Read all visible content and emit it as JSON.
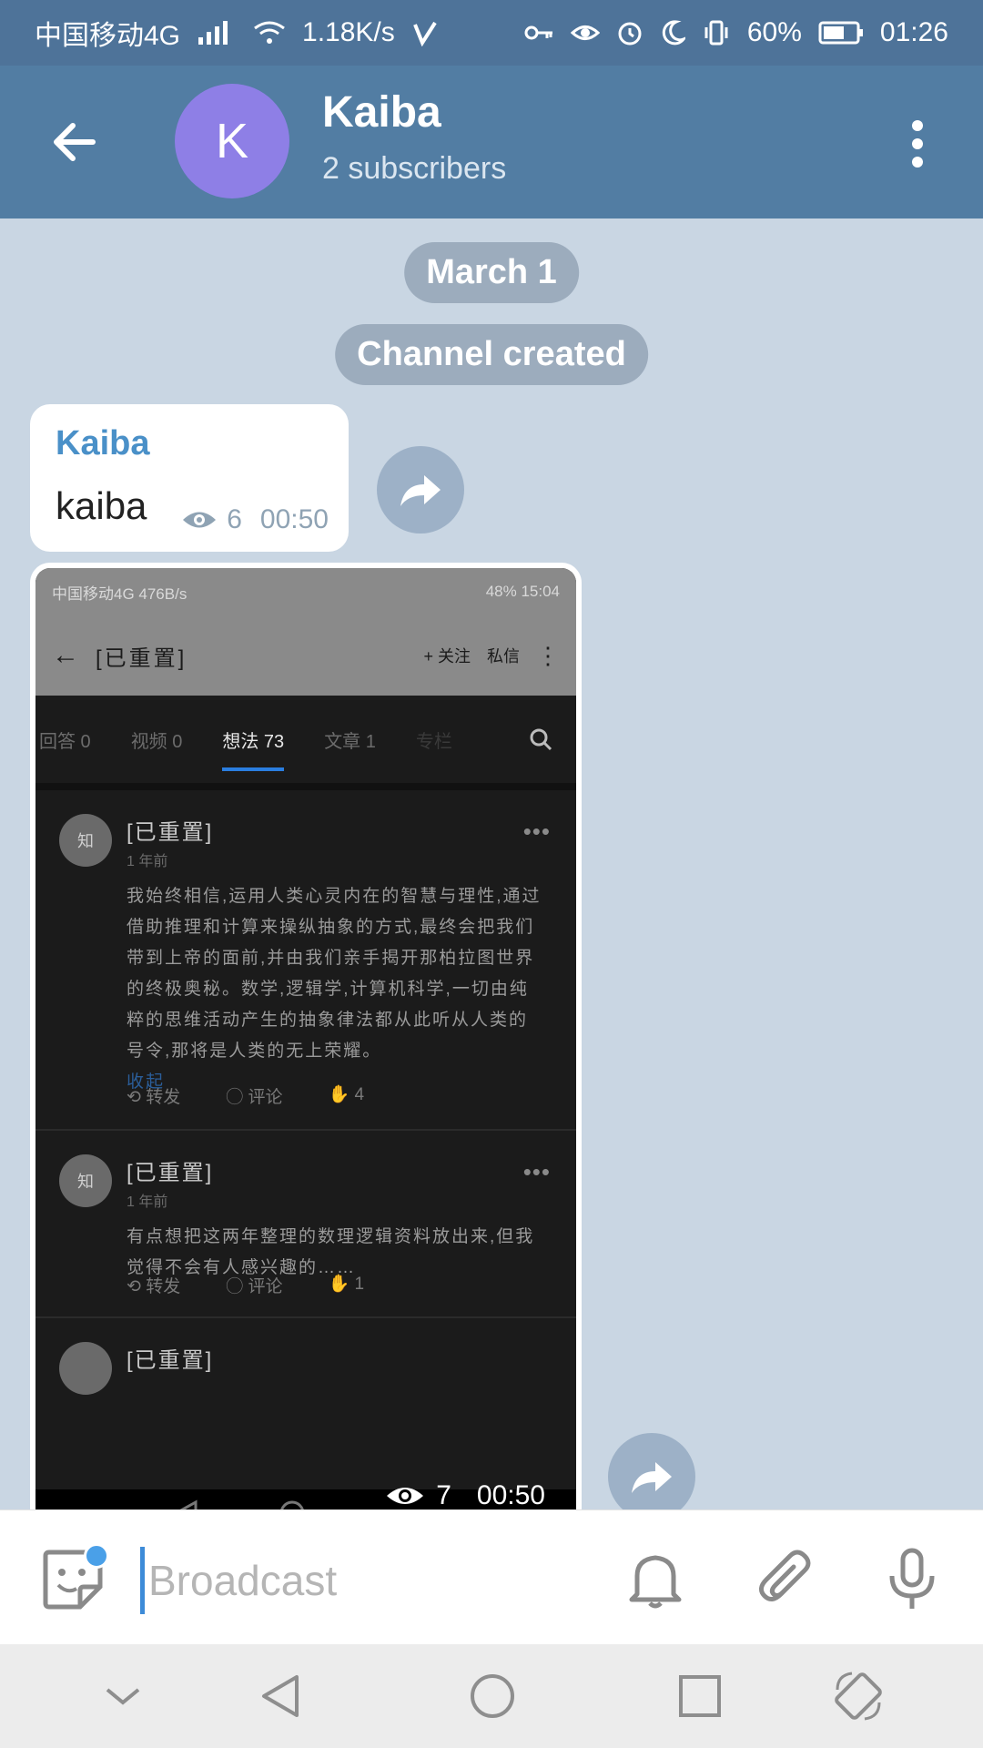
{
  "status_bar": {
    "carrier": "中国移动4G",
    "speed": "1.18K/s",
    "battery": "60%",
    "time": "01:26"
  },
  "header": {
    "avatar_letter": "K",
    "title": "Kaiba",
    "subtitle": "2 subscribers"
  },
  "chat": {
    "date_pill": "March 1",
    "service_pill": "Channel created",
    "message1": {
      "author": "Kaiba",
      "text": "kaiba",
      "views": "6",
      "time": "00:50"
    },
    "media": {
      "views": "7",
      "time": "00:50",
      "screenshot": {
        "status_left": "中国移动4G  476B/s",
        "status_right": "48%  15:04",
        "title": "[已重置]",
        "follow": "+ 关注",
        "message": "私信",
        "tabs": [
          "回答 0",
          "视频 0",
          "想法 73",
          "文章 1",
          "专栏"
        ],
        "posts": [
          {
            "avatar": "知",
            "name": "[已重置]",
            "time": "1 年前",
            "body": "我始终相信,运用人类心灵内在的智慧与理性,通过借助推理和计算来操纵抽象的方式,最终会把我们带到上帝的面前,并由我们亲手揭开那柏拉图世界的终极奥秘。数学,逻辑学,计算机科学,一切由纯粹的思维活动产生的抽象律法都从此听从人类的号令,那将是人类的无上荣耀。",
            "fold": "收起",
            "repost": "转发",
            "comment": "评论",
            "likes": "4"
          },
          {
            "avatar": "知",
            "name": "[已重置]",
            "time": "1 年前",
            "body": "有点想把这两年整理的数理逻辑资料放出来,但我觉得不会有人感兴趣的……",
            "repost": "转发",
            "comment": "评论",
            "likes": "1"
          },
          {
            "name": "[已重置]"
          }
        ]
      }
    }
  },
  "composer": {
    "placeholder": "Broadcast"
  },
  "colors": {
    "header": "#527da3",
    "status_bar": "#4e7399",
    "chat_bg": "#c9d6e3",
    "accent": "#4a90c8"
  }
}
